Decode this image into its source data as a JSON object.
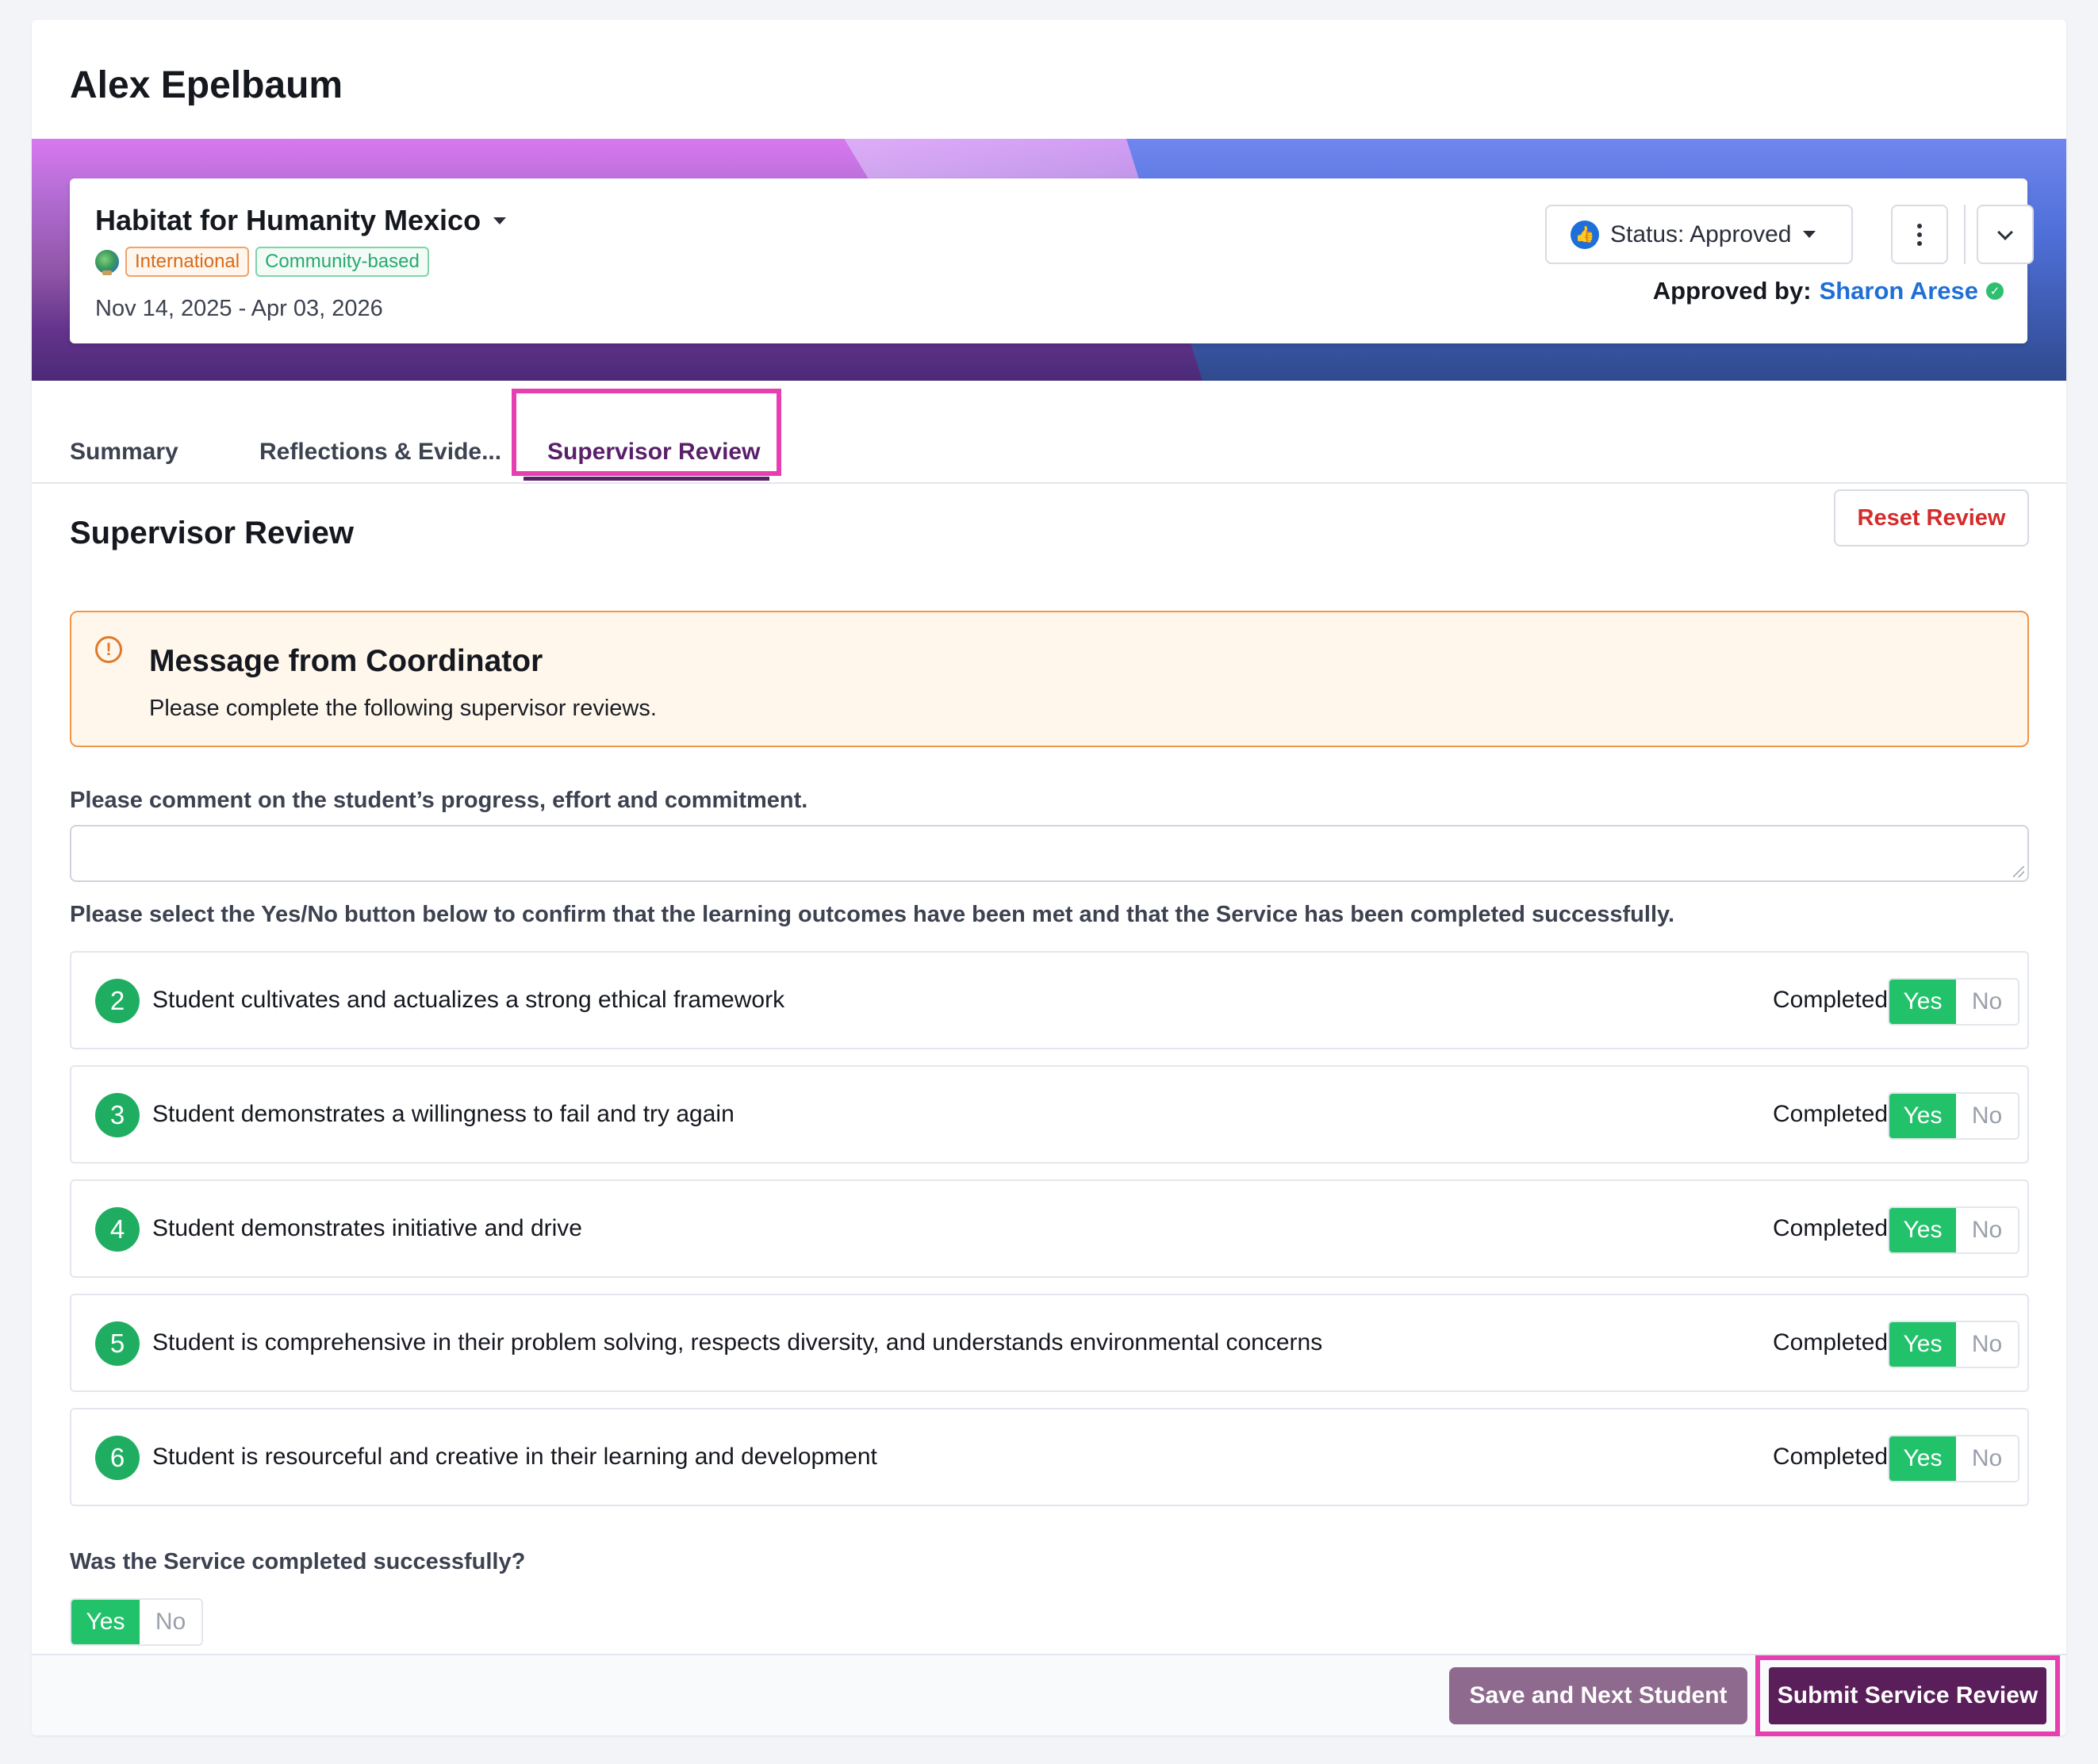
{
  "student": {
    "name": "Alex Epelbaum"
  },
  "service": {
    "title": "Habitat for Humanity Mexico",
    "tags": [
      "International",
      "Community-based"
    ],
    "dates": "Nov 14, 2025 - Apr 03, 2026",
    "status_label": "Status: Approved",
    "approved_by_label": "Approved by:",
    "approved_by_name": "Sharon Arese"
  },
  "tabs": [
    {
      "label": "Summary",
      "active": false
    },
    {
      "label": "Reflections & Evide...",
      "active": false
    },
    {
      "label": "Supervisor Review",
      "active": true
    }
  ],
  "review": {
    "title": "Supervisor Review",
    "reset_label": "Reset Review",
    "message": {
      "title": "Message from Coordinator",
      "body": "Please complete the following supervisor reviews."
    },
    "comment_prompt": "Please comment on the student’s progress, effort and commitment.",
    "comment_value": "",
    "confirm_prompt": "Please select the Yes/No button below to confirm that the learning outcomes have been met and that the Service has been completed successfully.",
    "completed_label": "Completed:",
    "yes_label": "Yes",
    "no_label": "No",
    "outcomes": [
      {
        "number": "2",
        "text": "Student cultivates and actualizes a strong ethical framework",
        "selected": "Yes"
      },
      {
        "number": "3",
        "text": "Student demonstrates a willingness to fail and try again",
        "selected": "Yes"
      },
      {
        "number": "4",
        "text": "Student demonstrates initiative and drive",
        "selected": "Yes"
      },
      {
        "number": "5",
        "text": "Student is comprehensive in their problem solving, respects diversity, and understands environmental concerns",
        "selected": "Yes"
      },
      {
        "number": "6",
        "text": "Student is resourceful and creative in their learning and development",
        "selected": "Yes"
      }
    ],
    "final_question": "Was the Service completed successfully?",
    "final_selected": "Yes"
  },
  "footer": {
    "save_next_label": "Save and Next Student",
    "submit_label": "Submit Service Review"
  },
  "colors": {
    "accent": "#5a1f6a",
    "highlight": "#e83fb0",
    "yes_active": "#22c26a",
    "link": "#1f6fd6",
    "danger": "#d42b2b"
  }
}
